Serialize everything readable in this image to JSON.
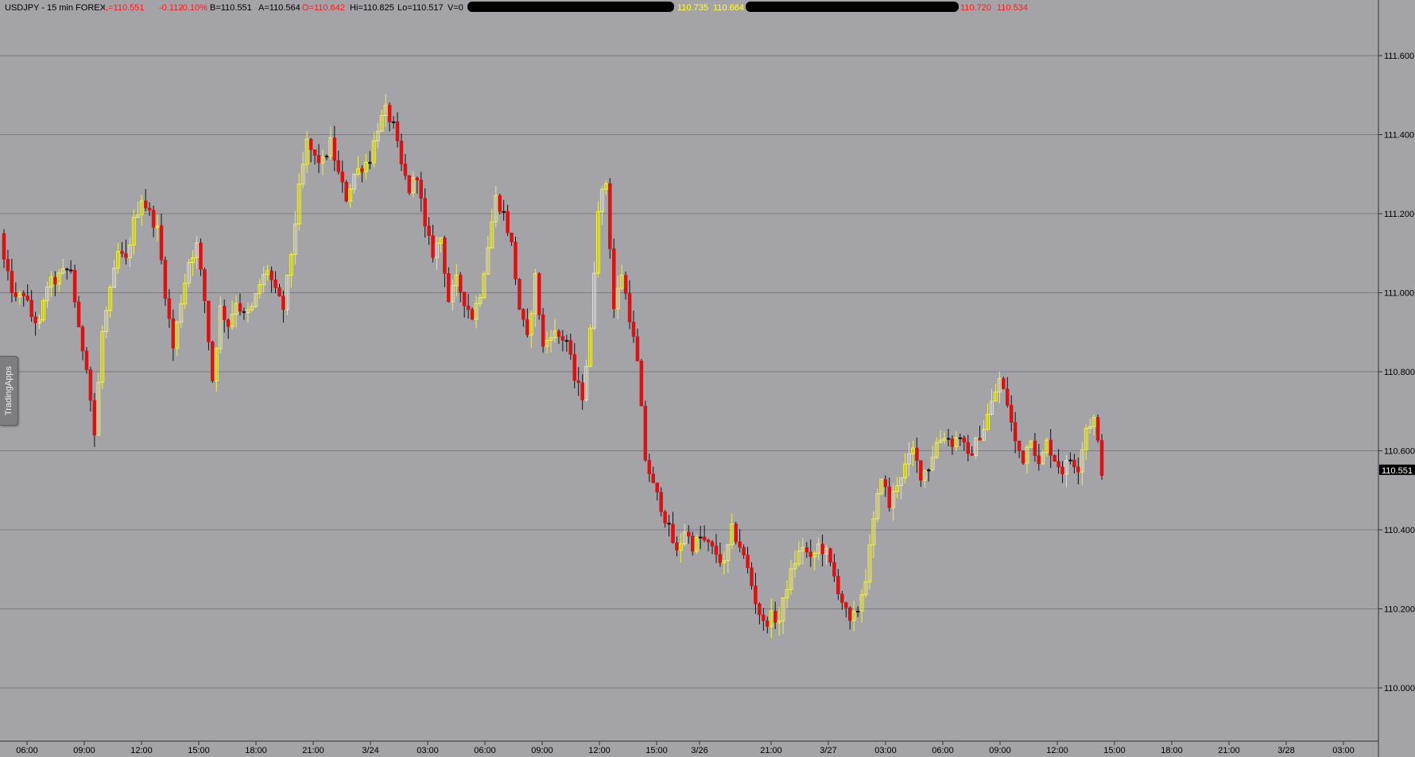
{
  "header": {
    "symbol": "USDJPY - 15 min  FOREX",
    "last": "L=110.551",
    "change": "-0.112",
    "change_pct": "-0.10%",
    "bid": "B=110.551",
    "ask": "A=110.564",
    "open": "O=110.642",
    "high": "Hi=110.825",
    "low": "Lo=110.517",
    "volume": "V=0",
    "ind1_a": "110.735",
    "ind1_b": "110.664",
    "ind2_a": "110.720",
    "ind2_b": "110.534"
  },
  "side_tab": {
    "label": "TradingApps"
  },
  "colors": {
    "background": "#a3a3a8",
    "up": "#f0f04a",
    "down": "#dd1111",
    "neutral": "#111111",
    "gridline": "#7c7c80",
    "header_red": "#ff1a1a",
    "header_yellow": "#ffff33"
  },
  "chart_data": {
    "type": "candlestick",
    "title": "USDJPY - 15 min  FOREX",
    "ylim": [
      109.85,
      111.72
    ],
    "y_ticks": [
      "111.600",
      "111.400",
      "111.200",
      "111.000",
      "110.800",
      "110.600",
      "110.400",
      "110.200",
      "110.000"
    ],
    "x_ticks": [
      "06:00",
      "09:00",
      "12:00",
      "15:00",
      "18:00",
      "21:00",
      "3/24",
      "03:00",
      "06:00",
      "09:00",
      "12:00",
      "15:00",
      "3/26",
      "21:00",
      "3/27",
      "03:00",
      "06:00",
      "09:00",
      "12:00",
      "15:00",
      "18:00",
      "21:00",
      "3/28",
      "03:00"
    ],
    "last_price": "110.551",
    "grid": true,
    "closes": [
      111.12,
      111.04,
      110.98,
      111.0,
      110.94,
      110.92,
      111.02,
      111.03,
      111.05,
      111.06,
      110.9,
      110.82,
      110.64,
      110.9,
      111.0,
      111.1,
      111.08,
      111.18,
      111.24,
      111.2,
      111.16,
      111.0,
      110.86,
      110.98,
      111.08,
      111.12,
      110.98,
      110.78,
      110.96,
      110.92,
      110.98,
      110.94,
      110.96,
      111.02,
      111.06,
      111.0,
      110.96,
      111.1,
      111.26,
      111.38,
      111.34,
      111.33,
      111.38,
      111.3,
      111.24,
      111.3,
      111.32,
      111.34,
      111.42,
      111.46,
      111.42,
      111.32,
      111.26,
      111.3,
      111.16,
      111.1,
      111.14,
      110.98,
      111.03,
      110.98,
      110.94,
      111.0,
      111.12,
      111.24,
      111.2,
      111.12,
      110.96,
      110.88,
      111.04,
      110.86,
      110.9,
      110.89,
      110.88,
      110.78,
      110.74,
      110.9,
      111.22,
      111.28,
      110.96,
      111.05,
      110.94,
      110.82,
      110.58,
      110.51,
      110.46,
      110.4,
      110.34,
      110.4,
      110.36,
      110.38,
      110.36,
      110.34,
      110.31,
      110.4,
      110.36,
      110.3,
      110.22,
      110.16,
      110.18,
      110.17,
      110.26,
      110.32,
      110.36,
      110.32,
      110.36,
      110.34,
      110.28,
      110.22,
      110.16,
      110.2,
      110.28,
      110.42,
      110.54,
      110.46,
      110.52,
      110.56,
      110.6,
      110.54,
      110.56,
      110.62,
      110.64,
      110.62,
      110.64,
      110.58,
      110.62,
      110.66,
      110.72,
      110.78,
      110.72,
      110.62,
      110.58,
      110.64,
      110.56,
      110.62,
      110.58,
      110.55,
      110.58,
      110.56,
      110.66,
      110.68,
      110.551
    ]
  }
}
